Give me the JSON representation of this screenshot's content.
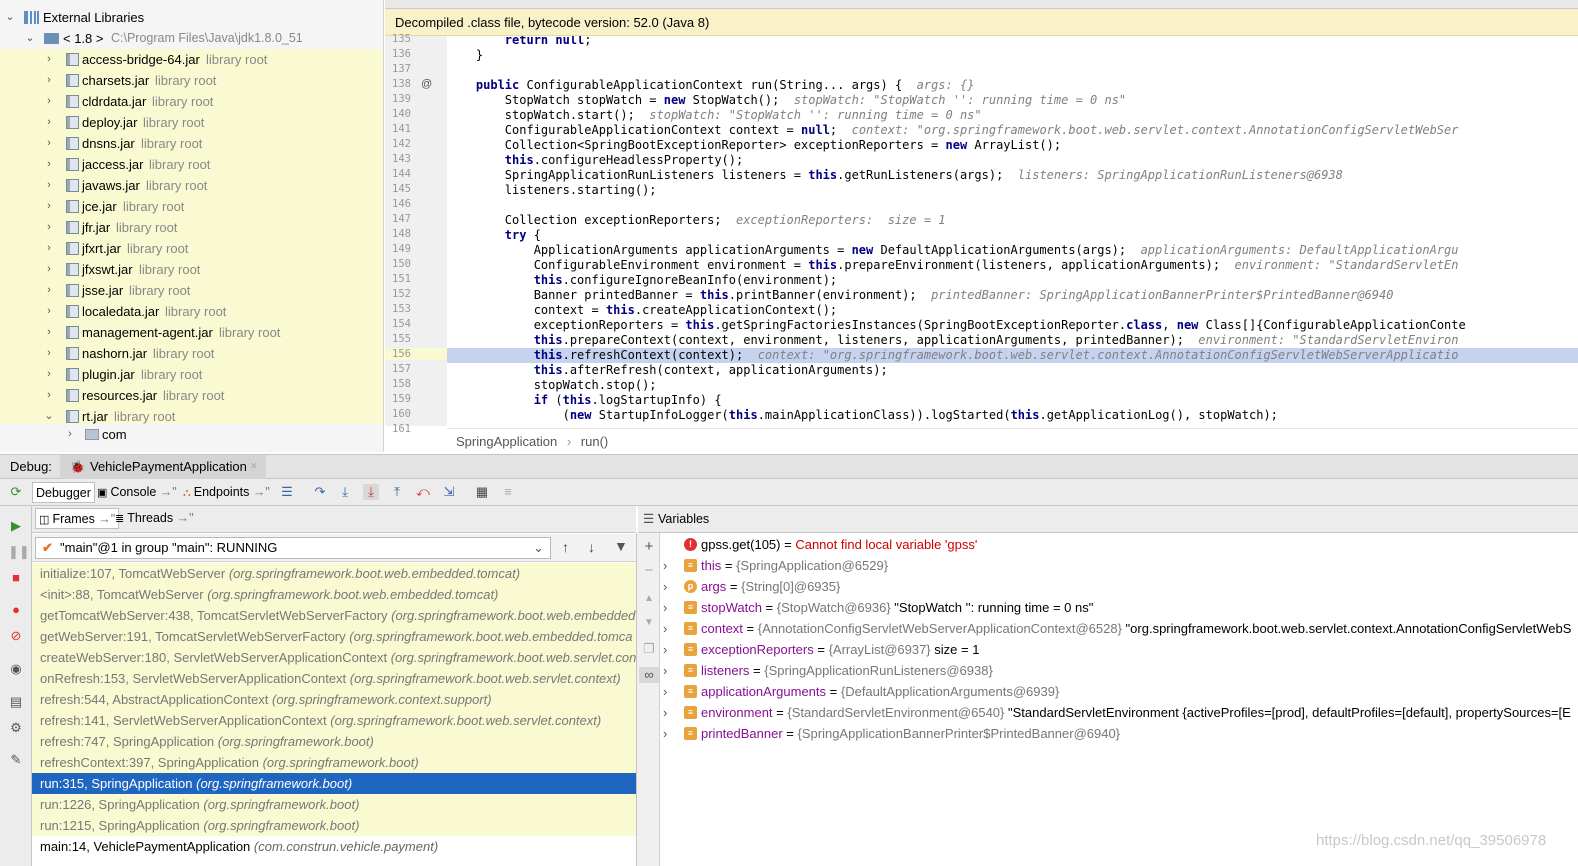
{
  "project_tree": {
    "external_libraries": "External Libraries",
    "jdk_label": "< 1.8 >",
    "jdk_path": "C:\\Program Files\\Java\\jdk1.8.0_51",
    "library_root": "library root",
    "jars": [
      "access-bridge-64.jar",
      "charsets.jar",
      "cldrdata.jar",
      "deploy.jar",
      "dnsns.jar",
      "jaccess.jar",
      "javaws.jar",
      "jce.jar",
      "jfr.jar",
      "jfxrt.jar",
      "jfxswt.jar",
      "jsse.jar",
      "localedata.jar",
      "management-agent.jar",
      "nashorn.jar",
      "plugin.jar",
      "resources.jar",
      "rt.jar"
    ],
    "com_label": "com"
  },
  "editor": {
    "banner": "Decompiled .class file, bytecode version: 52.0 (Java 8)",
    "line_numbers": [
      "135",
      "136",
      "137",
      "138",
      "139",
      "140",
      "141",
      "142",
      "143",
      "144",
      "145",
      "146",
      "147",
      "148",
      "149",
      "150",
      "151",
      "152",
      "153",
      "154",
      "155",
      "156",
      "157",
      "158",
      "159",
      "160",
      "161"
    ],
    "breadcrumb": [
      "SpringApplication",
      "run()"
    ]
  },
  "debug": {
    "label": "Debug:",
    "session": "VehiclePaymentApplication",
    "tabs": {
      "debugger": "Debugger",
      "console": "Console",
      "endpoints": "Endpoints"
    },
    "frames_tab": "Frames",
    "threads_tab": "Threads",
    "thread_selected": "\"main\"@1 in group \"main\": RUNNING",
    "frames": [
      {
        "method": "initialize:107, TomcatWebServer",
        "pkg": "(org.springframework.boot.web.embedded.tomcat)"
      },
      {
        "method": "<init>:88, TomcatWebServer",
        "pkg": "(org.springframework.boot.web.embedded.tomcat)"
      },
      {
        "method": "getTomcatWebServer:438, TomcatServletWebServerFactory",
        "pkg": "(org.springframework.boot.web.embedded"
      },
      {
        "method": "getWebServer:191, TomcatServletWebServerFactory",
        "pkg": "(org.springframework.boot.web.embedded.tomca"
      },
      {
        "method": "createWebServer:180, ServletWebServerApplicationContext",
        "pkg": "(org.springframework.boot.web.servlet.con"
      },
      {
        "method": "onRefresh:153, ServletWebServerApplicationContext",
        "pkg": "(org.springframework.boot.web.servlet.context)"
      },
      {
        "method": "refresh:544, AbstractApplicationContext",
        "pkg": "(org.springframework.context.support)"
      },
      {
        "method": "refresh:141, ServletWebServerApplicationContext",
        "pkg": "(org.springframework.boot.web.servlet.context)"
      },
      {
        "method": "refresh:747, SpringApplication",
        "pkg": "(org.springframework.boot)"
      },
      {
        "method": "refreshContext:397, SpringApplication",
        "pkg": "(org.springframework.boot)"
      },
      {
        "method": "run:315, SpringApplication",
        "pkg": "(org.springframework.boot)"
      },
      {
        "method": "run:1226, SpringApplication",
        "pkg": "(org.springframework.boot)"
      },
      {
        "method": "run:1215, SpringApplication",
        "pkg": "(org.springframework.boot)"
      },
      {
        "method": "main:14, VehiclePaymentApplication",
        "pkg": "(com.construn.vehicle.payment)"
      }
    ],
    "variables_tab": "Variables",
    "variables": [
      {
        "name": "gpss.get(105)",
        "eq": " = ",
        "type": "",
        "value": "Cannot find local variable 'gpss'"
      },
      {
        "name": "this",
        "eq": " = ",
        "type": "{SpringApplication@6529}",
        "value": ""
      },
      {
        "name": "args",
        "eq": " = ",
        "type": "{String[0]@6935}",
        "value": ""
      },
      {
        "name": "stopWatch",
        "eq": " = ",
        "type": "{StopWatch@6936}",
        "value": " \"StopWatch '': running time = 0 ns\""
      },
      {
        "name": "context",
        "eq": " = ",
        "type": "{AnnotationConfigServletWebServerApplicationContext@6528}",
        "value": " \"org.springframework.boot.web.servlet.context.AnnotationConfigServletWebS"
      },
      {
        "name": "exceptionReporters",
        "eq": " = ",
        "type": "{ArrayList@6937}",
        "value": "  size = 1"
      },
      {
        "name": "listeners",
        "eq": " = ",
        "type": "{SpringApplicationRunListeners@6938}",
        "value": ""
      },
      {
        "name": "applicationArguments",
        "eq": " = ",
        "type": "{DefaultApplicationArguments@6939}",
        "value": ""
      },
      {
        "name": "environment",
        "eq": " = ",
        "type": "{StandardServletEnvironment@6540}",
        "value": " \"StandardServletEnvironment {activeProfiles=[prod], defaultProfiles=[default], propertySources=[E"
      },
      {
        "name": "printedBanner",
        "eq": " = ",
        "type": "{SpringApplicationBannerPrinter$PrintedBanner@6940}",
        "value": ""
      }
    ]
  },
  "watermark": "https://blog.csdn.net/qq_39506978",
  "colors": {
    "keyword": "#000080",
    "comment": "#808080",
    "selected": "#1f66c1",
    "current_line": "#c6d3f0",
    "var_name": "#871094",
    "error": "#cc0000"
  }
}
